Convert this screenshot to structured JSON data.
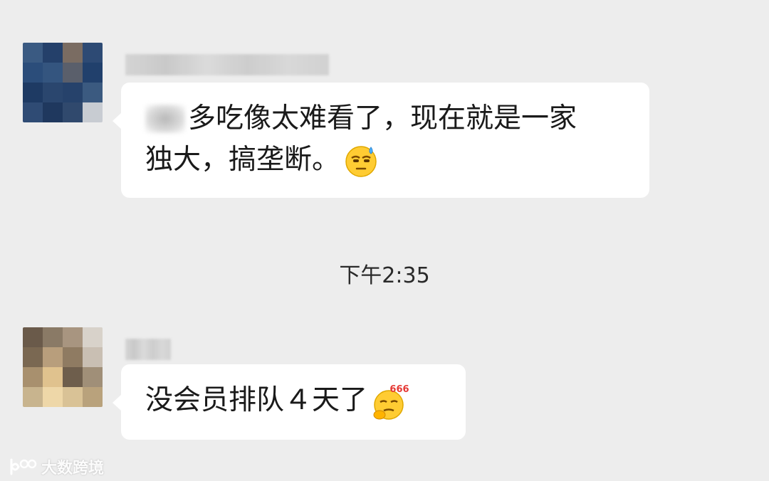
{
  "messages": [
    {
      "text_line1": "多吃像太难看了，现在就是一家",
      "text_line2": "独大，搞垄断。",
      "emoji": "sweat-smile-emoji"
    },
    {
      "text": "没会员排队４天了",
      "emoji": "666-emoji",
      "emoji_badge": "666"
    }
  ],
  "timestamp": "下午2:35",
  "watermark": {
    "text": "大数跨境",
    "icon": "brand-logo-icon"
  },
  "colors": {
    "background": "#ededed",
    "bubble": "#ffffff",
    "text": "#1a1a1a",
    "emoji_badge": "#e53935"
  }
}
